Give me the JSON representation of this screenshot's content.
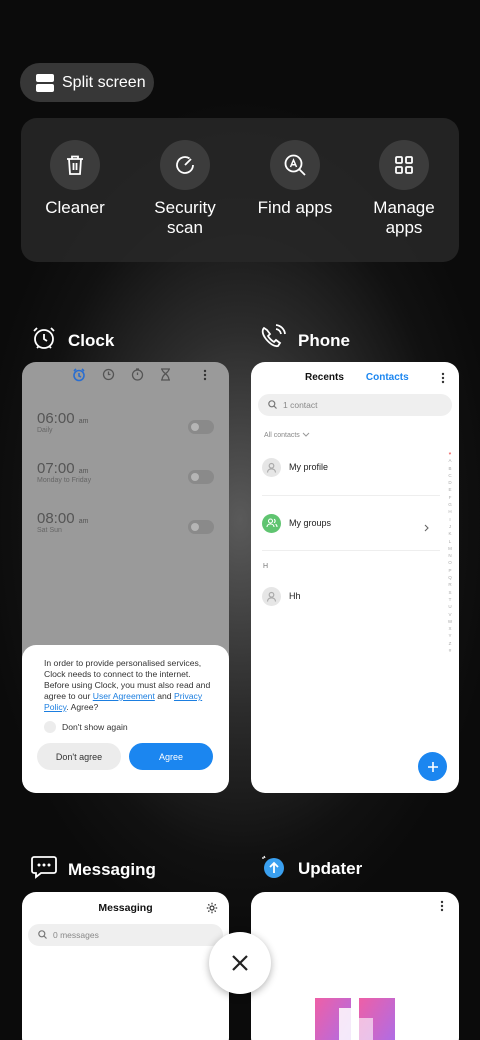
{
  "split_screen": {
    "label": "Split screen"
  },
  "tools": [
    {
      "label": "Cleaner",
      "icon": "trash-icon"
    },
    {
      "label": "Security scan",
      "icon": "security-scan-icon"
    },
    {
      "label": "Find apps",
      "icon": "find-apps-icon"
    },
    {
      "label": "Manage apps",
      "icon": "manage-apps-icon"
    }
  ],
  "apps": {
    "clock": {
      "title": "Clock"
    },
    "phone": {
      "title": "Phone"
    },
    "messaging": {
      "title": "Messaging"
    },
    "updater": {
      "title": "Updater"
    }
  },
  "clock_preview": {
    "alarms": [
      {
        "time": "06:00",
        "ampm": "am",
        "repeat": "Daily"
      },
      {
        "time": "07:00",
        "ampm": "am",
        "repeat": "Monday to Friday"
      },
      {
        "time": "08:00",
        "ampm": "am",
        "repeat": "Sat Sun"
      }
    ],
    "dialog": {
      "text_before": "In order to provide personalised services, Clock needs to connect to the internet. Before using Clock, you must also read and agree to our ",
      "link_user_agreement": "User Agreement",
      "text_and": " and ",
      "link_privacy": "Privacy Policy",
      "text_after": ". Agree?",
      "dont_show": "Don't show again",
      "disagree_label": "Don't agree",
      "agree_label": "Agree"
    }
  },
  "phone_preview": {
    "tab_recents": "Recents",
    "tab_contacts": "Contacts",
    "search_placeholder": "1 contact",
    "all_contacts": "All contacts",
    "my_profile": "My profile",
    "my_groups": "My groups",
    "section_h": "H",
    "contact_name": "Hh",
    "alphabet": [
      "♥",
      "A",
      "B",
      "C",
      "D",
      "E",
      "F",
      "G",
      "H",
      "I",
      "J",
      "K",
      "L",
      "M",
      "N",
      "O",
      "P",
      "Q",
      "R",
      "S",
      "T",
      "U",
      "V",
      "W",
      "X",
      "Y",
      "Z",
      "#"
    ]
  },
  "messaging_preview": {
    "title": "Messaging",
    "search_placeholder": "0 messages"
  },
  "colors": {
    "accent_blue": "#1b86f0",
    "group_green": "#5fc470",
    "updater_pink": "#ee5fa6",
    "updater_purple": "#a46ff0"
  }
}
